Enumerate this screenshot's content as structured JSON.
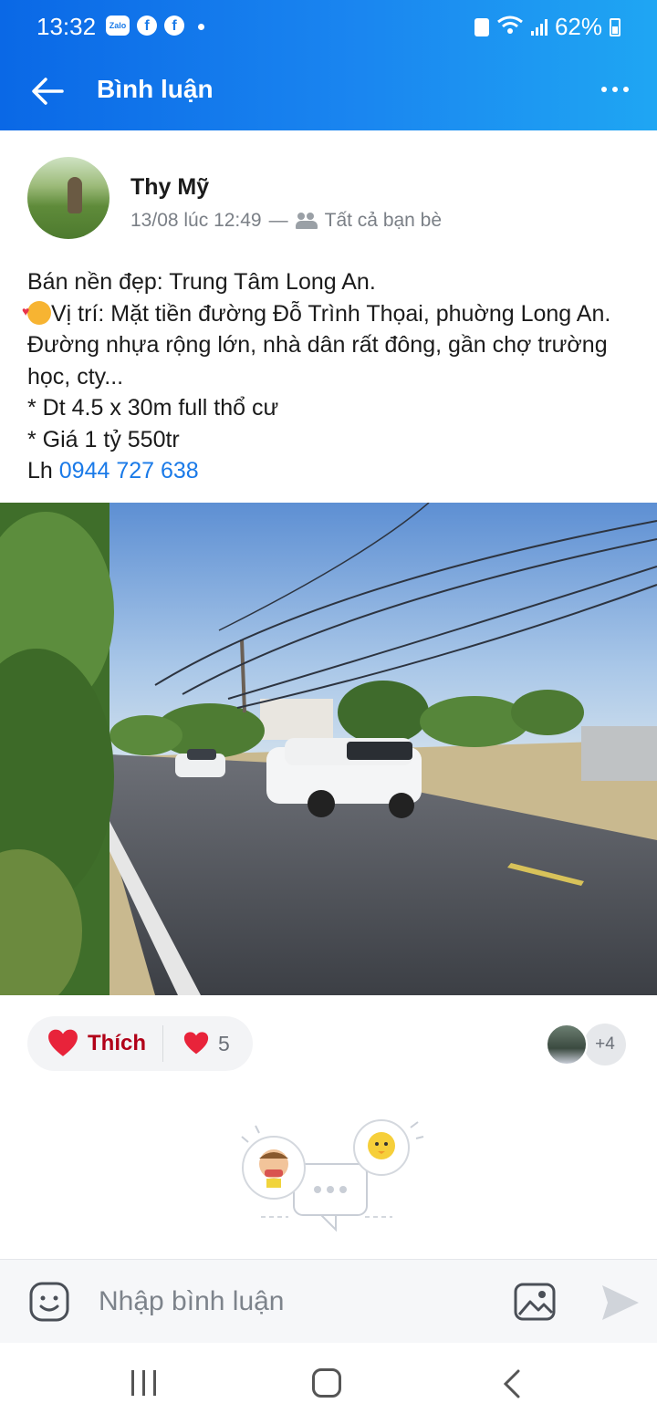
{
  "status_bar": {
    "time": "13:32",
    "notification_icons": [
      "zalo-icon",
      "facebook-icon",
      "facebook-icon",
      "dot-icon"
    ],
    "battery": "62%"
  },
  "app_bar": {
    "title": "Bình luận"
  },
  "post": {
    "author": "Thy Mỹ",
    "timestamp": "13/08 lúc 12:49",
    "separator": "—",
    "audience": "Tất cả bạn bè",
    "lines": [
      "Bán nền đẹp: Trung Tâm Long An.",
      "Vị trí: Mặt tiền đường Đỗ Trình Thọai, phuờng Long An. Đường nhựa rộng lớn, nhà dân rất đông, gần chợ trường học, cty...",
      "* Dt 4.5 x 30m full thổ cư",
      "* Giá 1 tỷ 550tr"
    ],
    "contact_prefix": "Lh",
    "phone": "0944 727 638"
  },
  "reactions": {
    "like_label": "Thích",
    "count": "5",
    "more_reactors": "+4"
  },
  "comment_bar": {
    "placeholder": "Nhập bình luận"
  },
  "colors": {
    "header_start": "#0a68e6",
    "header_end": "#1fa6f3",
    "link": "#1a7ae8",
    "like_red": "#b10018",
    "heart": "#e8344a"
  }
}
